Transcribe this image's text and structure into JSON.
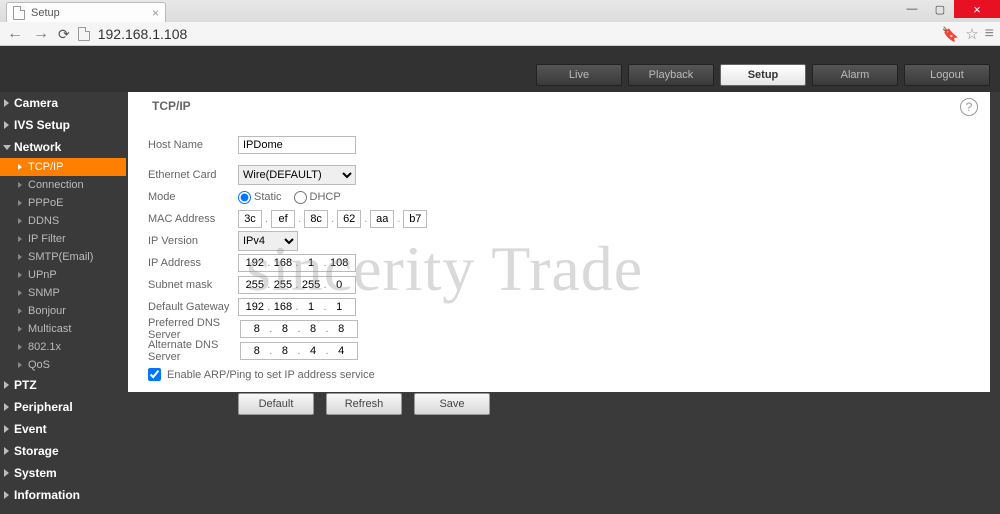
{
  "browser": {
    "tab_title": "Setup",
    "url": "192.168.1.108"
  },
  "nav_tabs": {
    "live": "Live",
    "playback": "Playback",
    "setup": "Setup",
    "alarm": "Alarm",
    "logout": "Logout"
  },
  "sidebar": {
    "camera": "Camera",
    "ivs": "IVS Setup",
    "network": "Network",
    "subs": {
      "tcpip": "TCP/IP",
      "connection": "Connection",
      "pppoe": "PPPoE",
      "ddns": "DDNS",
      "ipfilter": "IP Filter",
      "smtp": "SMTP(Email)",
      "upnp": "UPnP",
      "snmp": "SNMP",
      "bonjour": "Bonjour",
      "multicast": "Multicast",
      "x8021": "802.1x",
      "qos": "QoS"
    },
    "ptz": "PTZ",
    "peripheral": "Peripheral",
    "event": "Event",
    "storage": "Storage",
    "system": "System",
    "information": "Information"
  },
  "panel": {
    "tab": "TCP/IP",
    "labels": {
      "hostname": "Host Name",
      "ethernet": "Ethernet Card",
      "mode": "Mode",
      "mac": "MAC Address",
      "ipver": "IP Version",
      "ipaddr": "IP Address",
      "subnet": "Subnet mask",
      "gateway": "Default Gateway",
      "pdns": "Preferred DNS Server",
      "adns": "Alternate DNS Server"
    },
    "values": {
      "hostname": "IPDome",
      "ethernet": "Wire(DEFAULT)",
      "mode_static": "Static",
      "mode_dhcp": "DHCP",
      "ipver": "IPv4",
      "arp_label": "Enable ARP/Ping to set IP address service"
    },
    "mac": [
      "3c",
      "ef",
      "8c",
      "62",
      "aa",
      "b7"
    ],
    "ip": [
      "192",
      "168",
      "1",
      "108"
    ],
    "subnet": [
      "255",
      "255",
      "255",
      "0"
    ],
    "gateway": [
      "192",
      "168",
      "1",
      "1"
    ],
    "pdns": [
      "8",
      "8",
      "8",
      "8"
    ],
    "adns": [
      "8",
      "8",
      "4",
      "4"
    ],
    "buttons": {
      "default": "Default",
      "refresh": "Refresh",
      "save": "Save"
    }
  },
  "watermark": "sincerity Trade"
}
